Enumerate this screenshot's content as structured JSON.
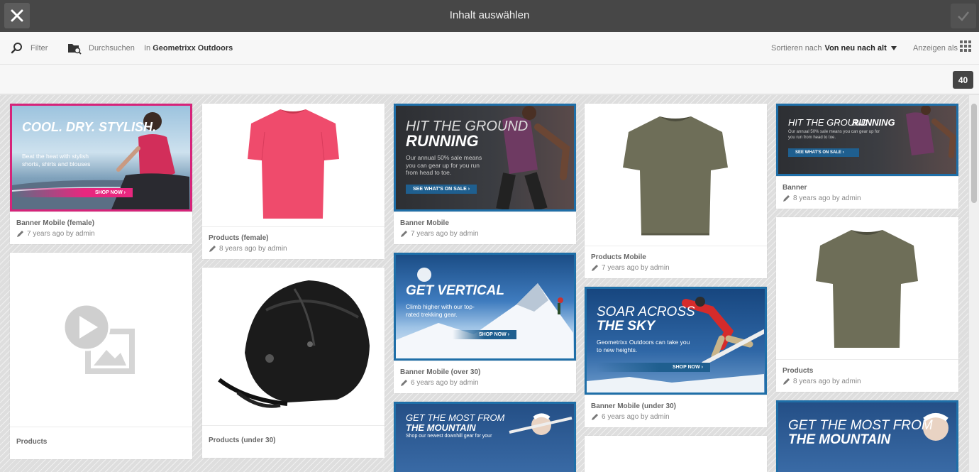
{
  "header": {
    "title": "Inhalt auswählen"
  },
  "toolbar": {
    "filter_label": "Filter",
    "browse_label": "Durchsuchen",
    "location_prefix": "In",
    "location_value": "Geometrixx Outdoors",
    "sort_label": "Sortieren nach",
    "sort_value": "Von neu nach alt",
    "view_label": "Anzeigen als"
  },
  "results": {
    "count": "40"
  },
  "cards": {
    "c1": {
      "title": "Banner Mobile (female)",
      "date": "7 years ago by admin",
      "headline": "COOL. DRY. STYLISH.",
      "sub": "Beat the heat with stylish shorts, shirts and blouses",
      "cta": "SHOP NOW ›"
    },
    "c2": {
      "title": "Products",
      "date": ""
    },
    "c3": {
      "title": "Products (female)",
      "date": "8 years ago by admin"
    },
    "c4": {
      "title": "Products (under 30)",
      "date": ""
    },
    "c5": {
      "title": "Banner Mobile",
      "date": "7 years ago by admin",
      "headline1": "HIT THE GROUND",
      "headline2": "RUNNING",
      "sub": "Our annual 50% sale means you can gear up for you run from head to toe.",
      "cta": "SEE WHAT'S ON SALE ›"
    },
    "c6": {
      "title": "Banner Mobile (over 30)",
      "date": "6 years ago by admin",
      "headline": "GET VERTICAL",
      "sub": "Climb higher with our top-rated trekking gear.",
      "cta": "SHOP NOW ›"
    },
    "c7": {
      "headline1": "GET THE MOST FROM",
      "headline2": "THE MOUNTAIN",
      "sub": "Shop our newest downhill gear for your"
    },
    "c8": {
      "title": "Products Mobile",
      "date": "7 years ago by admin"
    },
    "c9": {
      "title": "Banner Mobile (under 30)",
      "date": "6 years ago by admin",
      "headline1": "SOAR ACROSS",
      "headline2": "THE SKY",
      "sub": "Geometrixx Outdoors can take you to new heights.",
      "cta": "SHOP NOW ›"
    },
    "c10": {
      "title": "Banner",
      "date": "8 years ago by admin",
      "headline1": "HIT THE GROUND",
      "headline2": "RUNNING",
      "sub": "Our annual 50% sale means you can gear up for you run from head to toe.",
      "cta": "SEE WHAT'S ON SALE ›"
    },
    "c11": {
      "title": "Products",
      "date": "8 years ago by admin"
    },
    "c12": {
      "headline1": "GET THE MOST FROM",
      "headline2": "THE MOUNTAIN"
    }
  },
  "colors": {
    "topbar": "#474747",
    "pink_border": "#d6247a",
    "blue_border": "#1f6fa8",
    "accent_pink": "#e9277f"
  }
}
